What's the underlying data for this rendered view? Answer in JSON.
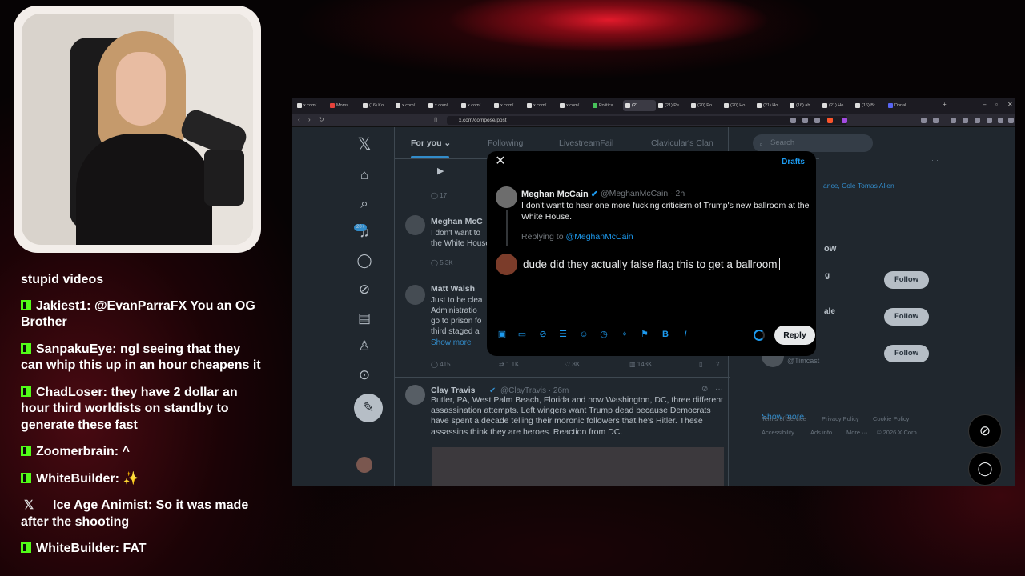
{
  "chat": {
    "messages": [
      {
        "user": "",
        "text": "stupid videos",
        "badge": "none"
      },
      {
        "user": "Jakiest1",
        "text": "@EvanParraFX You an OG Brother",
        "badge": "kick"
      },
      {
        "user": "SanpakuEye",
        "text": "ngl seeing that they can whip this up in an hour cheapens it",
        "badge": "kick"
      },
      {
        "user": "ChadLoser",
        "text": "they have 2 dollar an hour third worldists on standby to generate these fast",
        "badge": "kick"
      },
      {
        "user": "Zoomerbrain",
        "text": "^",
        "badge": "kick"
      },
      {
        "user": "WhiteBuilder",
        "text": "✨",
        "badge": "kick"
      },
      {
        "user": "Ice Age Animist",
        "text": "So it was made after the shooting",
        "badge": "x"
      },
      {
        "user": "WhiteBuilder",
        "text": "FAT",
        "badge": "kick"
      }
    ]
  },
  "browser": {
    "tabs": [
      {
        "label": "x.com/"
      },
      {
        "label": "Moms"
      },
      {
        "label": "(16) Ko"
      },
      {
        "label": "x.com/"
      },
      {
        "label": "x.com/"
      },
      {
        "label": "x.com/"
      },
      {
        "label": "x.com/"
      },
      {
        "label": "x.com/"
      },
      {
        "label": "x.com/"
      },
      {
        "label": "Politica"
      },
      {
        "label": "(21"
      },
      {
        "label": "(21) Pe"
      },
      {
        "label": "(20) Po"
      },
      {
        "label": "(20) Ho"
      },
      {
        "label": "(21) Ho"
      },
      {
        "label": "(16) ab"
      },
      {
        "label": "(21) Ho"
      },
      {
        "label": "(16) Br"
      },
      {
        "label": "Donal"
      }
    ],
    "url": "x.com/compose/post"
  },
  "x": {
    "nav_badge": "20+",
    "feed_tabs": [
      "For you",
      "Following",
      "LivestreamFail",
      "Clavicular's Clan"
    ],
    "posts": [
      {
        "name": "Meghan McC",
        "lines": [
          "I don't want to",
          "the White House"
        ],
        "metric": "5.3K"
      },
      {
        "name": "Matt Walsh",
        "lines": [
          "Just to be clea",
          "Administratio",
          "go to prison fo",
          "third staged a"
        ],
        "show_more": "Show more",
        "metrics": [
          "415",
          "1.1K",
          "8K",
          "143K"
        ]
      },
      {
        "name": "Clay Travis",
        "handle": "@ClayTravis · 26m",
        "text": "Butler, PA, West Palm Beach, Florida and now Washington, DC, three different assassination attempts. Left wingers want Trump dead because Democrats have spent a decade telling their moronic followers that he's Hitler. These assassins think they are heroes. Reaction from DC."
      }
    ],
    "top_metric": "17",
    "search_placeholder": "Search",
    "trend_snippet": "ance, Cole Tomas Allen",
    "who_to_follow": "ow",
    "follow_label": "Follow",
    "follow_names": [
      "g",
      "ale",
      ""
    ],
    "follow_handle_last": "@Timcast",
    "show_more": "Show more",
    "footer_links": [
      "Terms of Service",
      "Privacy Policy",
      "Cookie Policy",
      "Accessibility",
      "Ads info",
      "More ···",
      "© 2026 X Corp."
    ]
  },
  "modal": {
    "drafts": "Drafts",
    "quoted": {
      "name": "Meghan McCain",
      "handle": "@MeghanMcCain · 2h",
      "text": "I don't want to hear one more fucking criticism of Trump's new ballroom at the White House."
    },
    "replying_prefix": "Replying to",
    "replying_user": "@MeghanMcCain",
    "draft_text": "dude did they actually false flag this to get a ballroom",
    "reply_label": "Reply"
  },
  "colors": {
    "accent": "#1d9bf0",
    "kick": "#53fc18"
  }
}
